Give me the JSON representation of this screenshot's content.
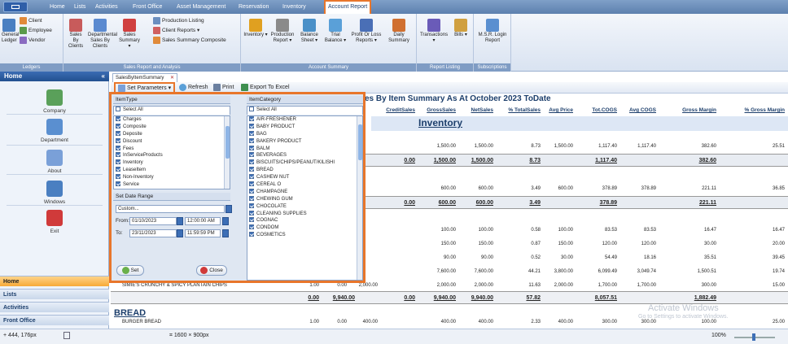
{
  "top_tabs": [
    "Home",
    "Lists",
    "Activities",
    "Front Office",
    "Asset Management",
    "Reservation",
    "Inventory",
    "Account Report"
  ],
  "ribbon": {
    "ledgers": {
      "buttons": [
        "General Ledger",
        "Client",
        "Employee",
        "Vendor"
      ],
      "label": "Ledgers"
    },
    "sales": {
      "buttons": [
        "Sales By Clients",
        "Departmental Sales By Clients",
        "Sales Summary ▾",
        "Production Listing",
        "Client Reports ▾",
        "Sales Summary Composite"
      ],
      "label": "Sales Report and Analysis"
    },
    "account": {
      "buttons": [
        "Inventory ▾",
        "Production Report ▾",
        "Balance Sheet ▾",
        "Trial Balance ▾",
        "Profit Or Loss Reports ▾",
        "Daily Summary"
      ],
      "label": "Account Summary"
    },
    "listing": {
      "buttons": [
        "Transactions ▾",
        "Bills ▾"
      ],
      "label": "Report Listing"
    },
    "subs": {
      "buttons": [
        "M.S.R. Login Report"
      ],
      "label": "Subscriptions"
    }
  },
  "nav": {
    "title": "Home",
    "collapse": "«",
    "items": [
      "Company",
      "Department",
      "About",
      "Windows",
      "Exit"
    ],
    "bars": [
      "Home",
      "Lists",
      "Activities",
      "Front Office"
    ]
  },
  "doc_tab": {
    "label": "SalesByItemSummary",
    "close": "✕"
  },
  "toolbar": {
    "set_params": "Set Parameters ▾",
    "refresh": "Refresh",
    "print": "Print",
    "export": "Export To Excel"
  },
  "report": {
    "title_partial": "es By Item Summary As At October 2023 ToDate",
    "col_first": "It",
    "columns": [
      "CreditSales",
      "GrossSales",
      "NetSales",
      "% TotalSales",
      "Avg Price",
      "Tot.COGS",
      "Avg COGS",
      "Gross Margin",
      "% Gross Margin"
    ],
    "section": "Inventory",
    "rows": [
      {
        "c": [
          "1,500.00",
          "1,500.00",
          "8.73",
          "1,500.00",
          "1,117.40",
          "1,117.40",
          "382.60",
          "25.51"
        ]
      },
      {
        "total": [
          "0.00",
          "1,500.00",
          "1,500.00",
          "8.73",
          "",
          "1,117.40",
          "",
          "382.60",
          ""
        ]
      },
      {
        "c": [
          "600.00",
          "600.00",
          "3.49",
          "600.00",
          "378.89",
          "378.89",
          "221.11",
          "36.85"
        ]
      },
      {
        "total": [
          "0.00",
          "600.00",
          "600.00",
          "3.49",
          "",
          "378.89",
          "",
          "221.11",
          ""
        ]
      },
      {
        "c": [
          "100.00",
          "100.00",
          "0.58",
          "100.00",
          "83.53",
          "83.53",
          "16.47",
          "16.47"
        ]
      },
      {
        "c": [
          "150.00",
          "150.00",
          "0.87",
          "150.00",
          "120.00",
          "120.00",
          "30.00",
          "20.00"
        ]
      },
      {
        "c": [
          "90.00",
          "90.00",
          "0.52",
          "30.00",
          "54.49",
          "18.16",
          "35.51",
          "39.45"
        ]
      },
      {
        "c": [
          "7,600.00",
          "7,600.00",
          "44.21",
          "3,800.00",
          "6,099.49",
          "3,049.74",
          "1,500.51",
          "19.74"
        ]
      },
      {
        "c": [
          "2,000.00",
          "2,000.00",
          "11.63",
          "2,000.00",
          "1,700.00",
          "1,700.00",
          "300.00",
          "15.00"
        ]
      }
    ],
    "simie_row": {
      "name": "SIMIE'S CRUNCHY & SPICY PLANTAIN CHIPS",
      "qty": "1.00",
      "disc": "0.00",
      "amt": "2,000.00"
    },
    "subtotal": {
      "pre": [
        "0.00",
        "9,940.00",
        "0.00"
      ],
      "vals": [
        "9,940.00",
        "9,940.00",
        "57.82",
        "",
        "8,057.51",
        "",
        "1,882.49",
        ""
      ]
    },
    "bread_section": "BREAD",
    "bread_row": {
      "name": "BURGER BREAD",
      "qty": "1.00",
      "disc": "0.00",
      "amt": "400.00",
      "vals": [
        "400.00",
        "400.00",
        "2.33",
        "400.00",
        "300.00",
        "300.00",
        "100.00",
        "25.00"
      ]
    }
  },
  "popup": {
    "item_type_head": "ItemType",
    "select_all": "Select All",
    "item_types": [
      "Charges",
      "Composite",
      "Deposite",
      "Discount",
      "Fees",
      "InServiceProducts",
      "Inventory",
      "LeaseItem",
      "Non-Inventory",
      "Service"
    ],
    "item_cat_head": "ItemCategory",
    "item_categories": [
      "AIR-FRESHENER",
      "BABY PRODUCT",
      "BAG",
      "BAKERY PRODUCT",
      "BALM",
      "BEVERAGES",
      "BISCUITS/CHIPS/PEANUT/KILISHI",
      "BREAD",
      "CASHEW NUT",
      "CEREAL O",
      "CHAMPAGNE",
      "CHEWING GUM",
      "CHOCOLATE",
      "CLEANING SUPPLIES",
      "COGNAC",
      "CONDOM",
      "COSMETICS"
    ],
    "date_head": "Set Date Range",
    "range": "Custom...",
    "from_label": "From:",
    "from_date": "01/10/2023",
    "from_time": "12:00:00 AM",
    "to_label": "To:",
    "to_date": "23/11/2023",
    "to_time": "11:59:59 PM",
    "set": "Set",
    "close": "Close"
  },
  "watermark": {
    "line1": "Activate Windows",
    "line2": "Go to Settings to activate Windows."
  },
  "status": {
    "coords": "444, 176px",
    "size": "1600 × 900px",
    "zoom": "100%"
  },
  "colors": {
    "accent": "#e8762b",
    "ribbon_blue": "#7f9cc4",
    "header_text": "#1d3f6c"
  }
}
